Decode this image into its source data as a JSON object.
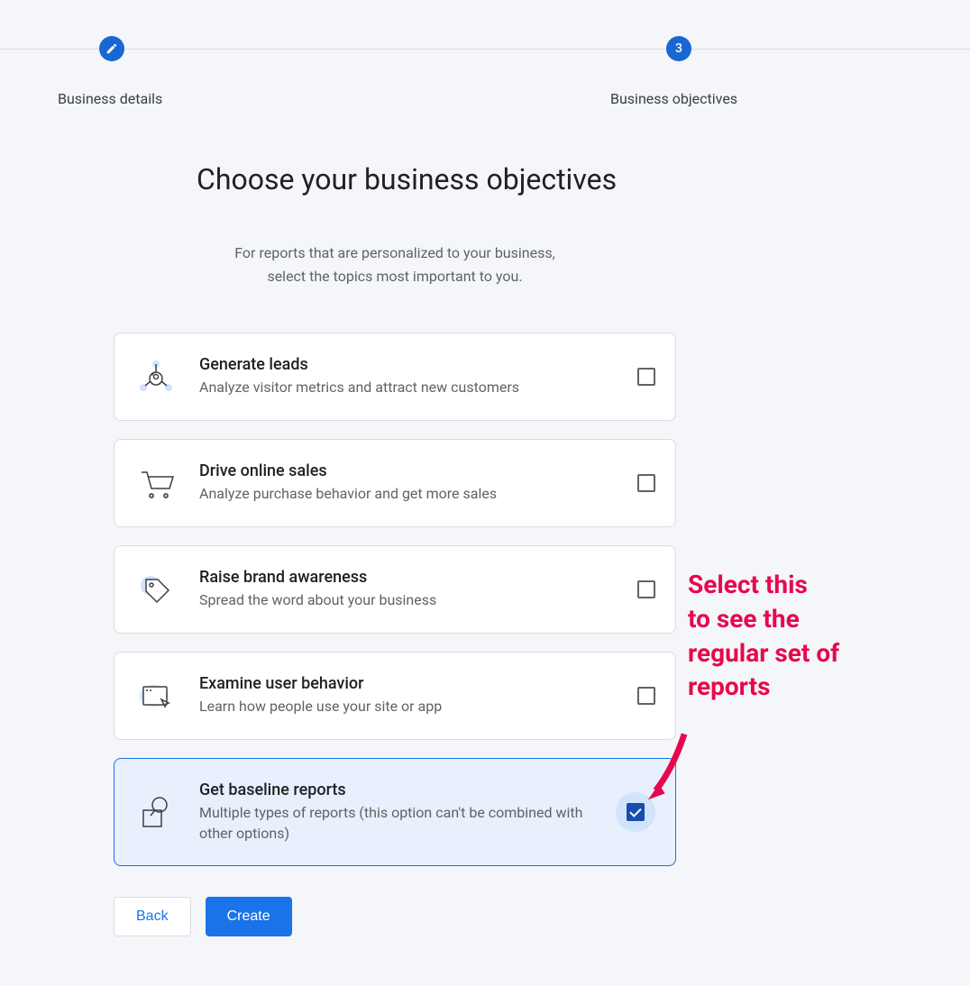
{
  "stepper": {
    "step1": {
      "label": "Business details"
    },
    "step2": {
      "label": "Business objectives",
      "number": "3"
    }
  },
  "main": {
    "heading": "Choose your business objectives",
    "subtext_line1": "For reports that are personalized to your business,",
    "subtext_line2": "select the topics most important to you."
  },
  "cards": [
    {
      "title": "Generate leads",
      "desc": "Analyze visitor metrics and attract new customers",
      "checked": false
    },
    {
      "title": "Drive online sales",
      "desc": "Analyze purchase behavior and get more sales",
      "checked": false
    },
    {
      "title": "Raise brand awareness",
      "desc": "Spread the word about your business",
      "checked": false
    },
    {
      "title": "Examine user behavior",
      "desc": "Learn how people use your site or app",
      "checked": false
    },
    {
      "title": "Get baseline reports",
      "desc": "Multiple types of reports (this option can't be combined with other options)",
      "checked": true
    }
  ],
  "buttons": {
    "back": "Back",
    "create": "Create"
  },
  "annotation": {
    "line1": "Select this",
    "line2": "to see the",
    "line3": "regular set of",
    "line4": "reports"
  }
}
